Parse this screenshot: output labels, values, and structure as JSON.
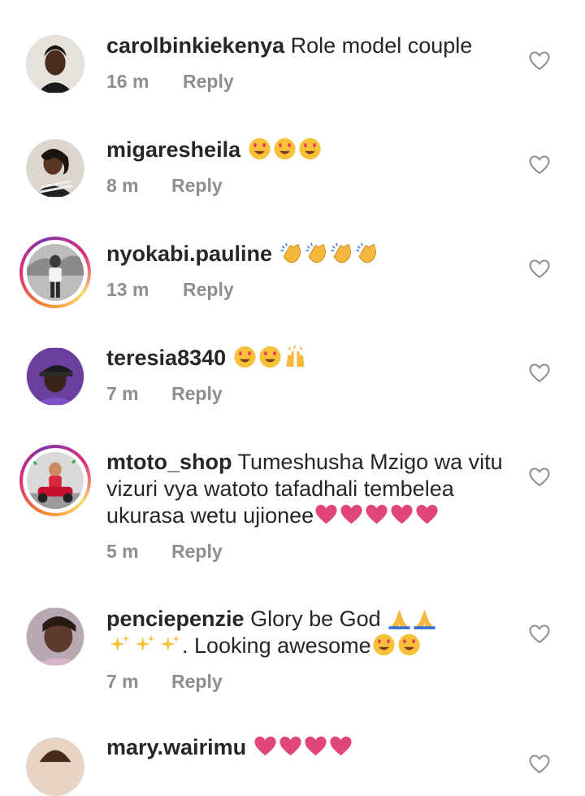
{
  "comments": [
    {
      "username": "carolbinkiekenya",
      "text": "Role model couple",
      "emoji_after": [],
      "time": "16 m",
      "reply_label": "Reply",
      "story_ring": false
    },
    {
      "username": "migaresheila",
      "text": "",
      "emoji_after": [
        "heart-eyes",
        "heart-eyes",
        "heart-eyes"
      ],
      "time": "8 m",
      "reply_label": "Reply",
      "story_ring": false
    },
    {
      "username": "nyokabi.pauline",
      "text": "",
      "emoji_after": [
        "clap",
        "clap",
        "clap",
        "clap"
      ],
      "time": "13 m",
      "reply_label": "Reply",
      "story_ring": true
    },
    {
      "username": "teresia8340",
      "text": "",
      "emoji_after": [
        "heart-eyes",
        "heart-eyes",
        "raised-hands"
      ],
      "time": "7 m",
      "reply_label": "Reply",
      "story_ring": false
    },
    {
      "username": "mtoto_shop",
      "text_line1": "Tumeshusha Mzigo wa vitu",
      "text_line2": "vizuri vya watoto tafadhali tembelea",
      "text_line3": "ukurasa wetu ujionee",
      "emoji_after": [
        "pink-heart",
        "pink-heart",
        "pink-heart",
        "pink-heart",
        "pink-heart"
      ],
      "time": "5 m",
      "reply_label": "Reply",
      "story_ring": true
    },
    {
      "username": "penciepenzie",
      "text_line1": "Glory be God",
      "text_line2": ". Looking awesome",
      "emoji_line1": [
        "folded-hands",
        "folded-hands"
      ],
      "emoji_line2_before": [
        "sparkles",
        "sparkles",
        "sparkles"
      ],
      "emoji_line2_after": [
        "heart-eyes",
        "heart-eyes"
      ],
      "time": "7 m",
      "reply_label": "Reply",
      "story_ring": false
    },
    {
      "username": "mary.wairimu",
      "text": "",
      "emoji_after": [
        "pink-heart",
        "pink-heart",
        "pink-heart",
        "pink-heart"
      ],
      "story_ring": false
    }
  ],
  "colors": {
    "username": "#262626",
    "meta": "#8e8e8e",
    "heart_outline": "#8e8e8e",
    "pink_heart": "#e0457b",
    "story_ring": "#dd2a7b"
  }
}
